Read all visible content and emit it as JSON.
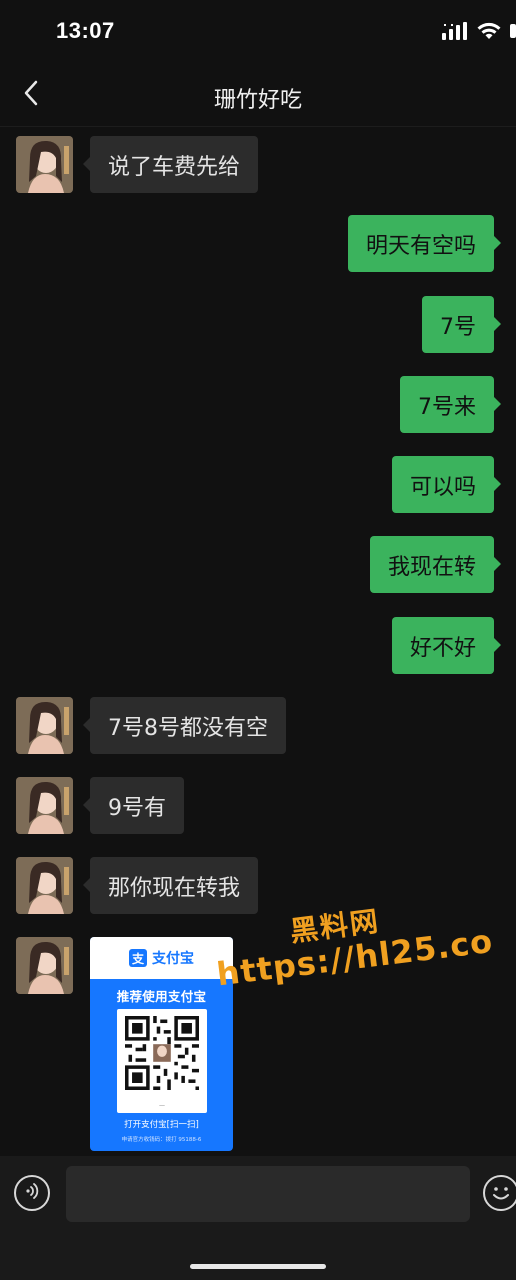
{
  "status_bar": {
    "time": "13:07"
  },
  "header": {
    "title": "珊竹好吃"
  },
  "messages": [
    {
      "side": "left",
      "text": "说了车费先给"
    },
    {
      "side": "right",
      "text": "明天有空吗"
    },
    {
      "side": "right",
      "text": "7号"
    },
    {
      "side": "right",
      "text": "7号来"
    },
    {
      "side": "right",
      "text": "可以吗"
    },
    {
      "side": "right",
      "text": "我现在转"
    },
    {
      "side": "right",
      "text": "好不好"
    },
    {
      "side": "left",
      "text": "7号8号都没有空"
    },
    {
      "side": "left",
      "text": "9号有"
    },
    {
      "side": "left",
      "text": "那你现在转我"
    }
  ],
  "alipay_card": {
    "logo_char": "支",
    "brand": "支付宝",
    "headline": "推荐使用支付宝",
    "footer": "打开支付宝[扫一扫]",
    "footer_small": "申请官方收钱码：拨打 95188-6"
  },
  "watermark": {
    "line1": "黑料网",
    "line2": "https://hl25.co"
  },
  "colors": {
    "background": "#111111",
    "incoming_bubble": "#2c2c2c",
    "outgoing_bubble": "#3bb35d",
    "alipay_blue": "#1677ff",
    "watermark": "#f0a020"
  },
  "icons": {
    "back": "chevron-left-icon",
    "voice": "voice-icon",
    "emoji": "emoji-icon",
    "signal": "signal-icon",
    "wifi": "wifi-icon"
  }
}
